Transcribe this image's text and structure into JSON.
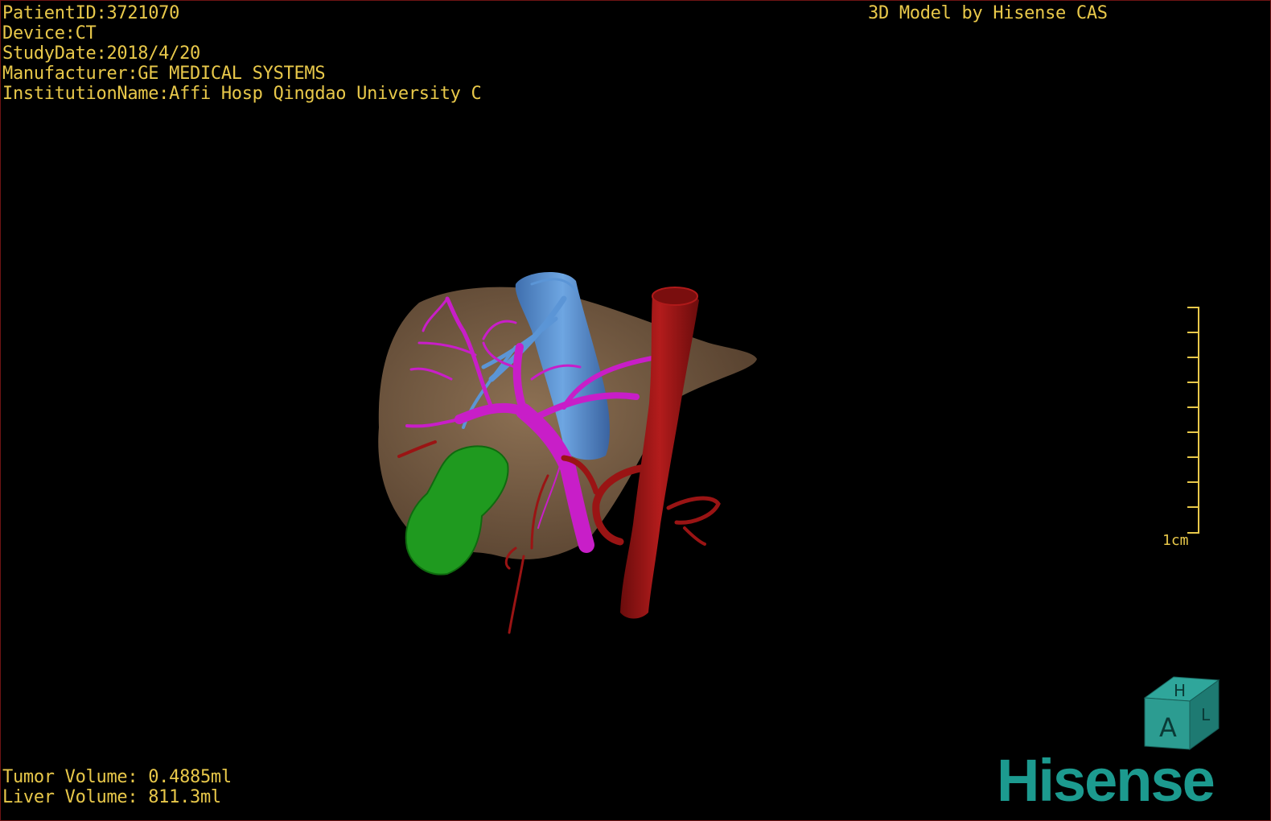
{
  "info": {
    "patient_id": "PatientID:3721070",
    "device": "Device:CT",
    "study_date": "StudyDate:2018/4/20",
    "manufacturer": "Manufacturer:GE MEDICAL SYSTEMS",
    "institution": "InstitutionName:Affi Hosp Qingdao University C"
  },
  "credit": "3D Model by Hisense CAS",
  "volumes": {
    "tumor": "Tumor Volume: 0.4885ml",
    "liver": "Liver Volume: 811.3ml"
  },
  "scale": {
    "label": "1cm"
  },
  "orientation": {
    "front": "A",
    "top": "H",
    "side": "L"
  },
  "brand": "Hisense",
  "colors": {
    "overlay_text": "#e8c84a",
    "liver": "#7a6047",
    "tumor": "#1f9a1f",
    "portal_vein": "#c81ec8",
    "ivc": "#5b95d6",
    "aorta": "#9a1414",
    "brand": "#1c9a8f"
  }
}
